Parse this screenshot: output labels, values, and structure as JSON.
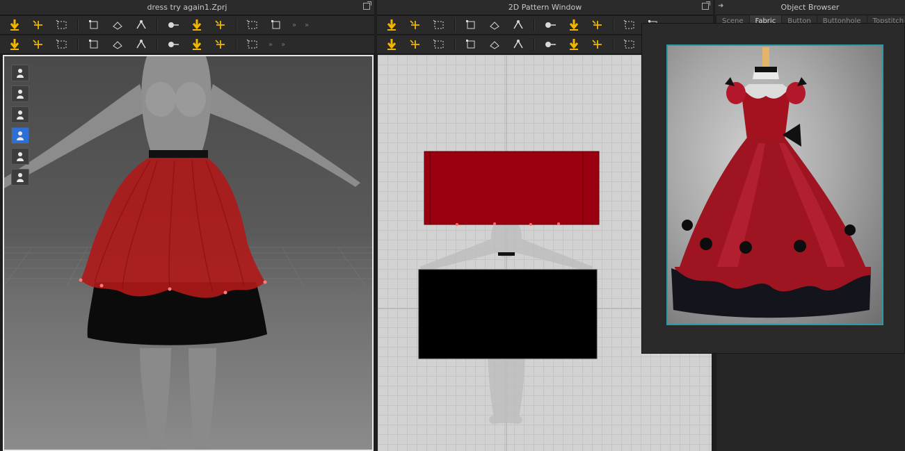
{
  "viewport3d_window": {
    "title": "dress try again1.Zprj"
  },
  "pattern_window": {
    "title": "2D Pattern Window"
  },
  "object_browser": {
    "title": "Object Browser",
    "tabs": [
      "Scene",
      "Fabric",
      "Button",
      "Buttonhole",
      "Topstitch"
    ],
    "active_tab": "Fabric"
  },
  "colors": {
    "skirt_red": "#b01818",
    "pattern_red": "#9b0010",
    "lining_black": "#0a0a0a",
    "accent_yellow": "#f2b600",
    "active_tool_blue": "#2d6fd6",
    "viewer_frame": "#2b9aa8"
  },
  "toolbar_3d": {
    "row1_icons": [
      "move-down-icon",
      "transform-move-icon",
      "select-box-icon",
      "transform-box-icon",
      "fold-icon",
      "tack-icon",
      "pin-icon",
      "garment-fit-icon",
      "pencil-line-icon",
      "sewing-eye-icon",
      "shirt-fit-icon"
    ],
    "row2_icons": [
      "walk-avatar-icon",
      "arrange-icon",
      "pin-point-icon",
      "measure-icon",
      "cut-icon",
      "steam-icon",
      "iron-icon",
      "trims-icon",
      "button-icon",
      "button-hole-icon"
    ]
  },
  "toolbar_2d": {
    "row1_icons": [
      "pattern-select-icon",
      "edit-point-icon",
      "edit-curve-icon",
      "curve-point-icon",
      "add-point-icon",
      "segment-icon",
      "polygon-icon",
      "internal-shape-icon",
      "rectangle-icon",
      "circle-icon",
      "dart-icon"
    ],
    "row2_icons": [
      "seam-edit-icon",
      "segment-sew-icon",
      "free-sew-icon",
      "tack-sew-icon",
      "notch-icon",
      "iron-icon",
      "fold-arrange-icon",
      "button-icon",
      "texture-icon",
      "zipper-icon"
    ]
  },
  "viewport_tools": [
    "garment-show-icon",
    "garment-hide-icon",
    "avatar-icon",
    "texture-view-icon",
    "pen-icon",
    "avatar-solid-icon"
  ],
  "reference_image": {
    "subject": "red-ball-gown-photo"
  }
}
